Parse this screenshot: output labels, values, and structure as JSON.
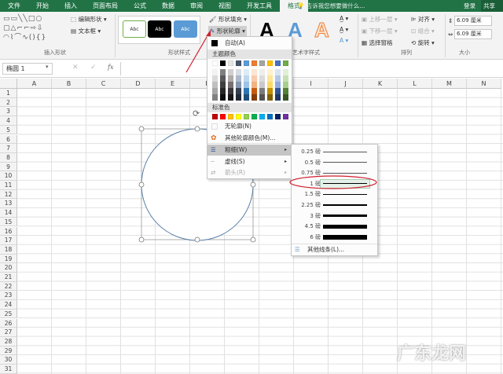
{
  "tabs": [
    "文件",
    "开始",
    "插入",
    "页面布局",
    "公式",
    "数据",
    "审阅",
    "视图",
    "开发工具",
    "格式"
  ],
  "tell_me": "告诉我您想要做什么...",
  "login": "登录",
  "share": "共享",
  "ribbon": {
    "insert_shapes": {
      "edit_shape": "编辑形状",
      "text_box": "文本框",
      "label": "插入形状"
    },
    "shape_styles": {
      "abc": "Abc",
      "fill": "形状填充",
      "outline": "形状轮廓",
      "label": "形状样式"
    },
    "wordart": {
      "letter": "A",
      "label": "艺术字样式"
    },
    "arrange": {
      "bring_forward": "上移一层",
      "send_backward": "下移一层",
      "selection_pane": "选择窗格",
      "align": "对齐",
      "group": "组合",
      "rotate": "旋转",
      "label": "排列"
    },
    "size": {
      "height": "6.09 厘米",
      "width": "6.09 厘米",
      "label": "大小"
    }
  },
  "formula_bar": {
    "name_box": "椭圆 1",
    "fx": "fx"
  },
  "columns": [
    "A",
    "B",
    "C",
    "D",
    "E",
    "F",
    "G",
    "H",
    "I",
    "J",
    "K",
    "L",
    "M",
    "N"
  ],
  "rows": [
    "1",
    "2",
    "3",
    "4",
    "5",
    "6",
    "7",
    "8",
    "9",
    "10",
    "11",
    "12",
    "13",
    "14",
    "15",
    "16",
    "17",
    "18",
    "19",
    "20",
    "21",
    "22",
    "23",
    "24",
    "25",
    "26",
    "27",
    "28",
    "29",
    "30",
    "31"
  ],
  "outline_menu": {
    "auto": "自动(A)",
    "theme_colors": "主题颜色",
    "theme_top": [
      "#ffffff",
      "#000000",
      "#e7e6e6",
      "#44546a",
      "#5b9bd5",
      "#ed7d31",
      "#a5a5a5",
      "#ffc000",
      "#4472c4",
      "#70ad47"
    ],
    "theme_shades": [
      [
        "#f2f2f2",
        "#d9d9d9",
        "#bfbfbf",
        "#a6a6a6",
        "#808080"
      ],
      [
        "#7f7f7f",
        "#595959",
        "#404040",
        "#262626",
        "#0d0d0d"
      ],
      [
        "#d0cece",
        "#aeaaaa",
        "#757171",
        "#3a3838",
        "#171616"
      ],
      [
        "#d6dce4",
        "#adb9ca",
        "#8496b0",
        "#333f4f",
        "#222a35"
      ],
      [
        "#deebf6",
        "#bdd7ee",
        "#9dc3e6",
        "#2e75b5",
        "#1f4e79"
      ],
      [
        "#fbe5d5",
        "#f7cbac",
        "#f4b183",
        "#c55a11",
        "#833c0b"
      ],
      [
        "#ededed",
        "#dbdbdb",
        "#c9c9c9",
        "#7b7b7b",
        "#525252"
      ],
      [
        "#fff2cc",
        "#fee599",
        "#ffd965",
        "#bf9000",
        "#7f6000"
      ],
      [
        "#dae3f3",
        "#b4c7e7",
        "#8faadc",
        "#2f5496",
        "#1f3864"
      ],
      [
        "#e2efd9",
        "#c5e0b3",
        "#a8d08d",
        "#538135",
        "#375623"
      ]
    ],
    "standard_colors_label": "标准色",
    "standard_colors": [
      "#c00000",
      "#ff0000",
      "#ffc000",
      "#ffff00",
      "#92d050",
      "#00b050",
      "#00b0f0",
      "#0070c0",
      "#002060",
      "#7030a0"
    ],
    "no_outline": "无轮廓(N)",
    "more_colors": "其他轮廓颜色(M)...",
    "weight": "粗细(W)",
    "dashes": "虚线(S)",
    "arrows": "箭头(R)"
  },
  "weight_menu": {
    "items": [
      {
        "label": "0.25 磅",
        "pt": 0.25
      },
      {
        "label": "0.5 磅",
        "pt": 0.5
      },
      {
        "label": "0.75 磅",
        "pt": 0.75
      },
      {
        "label": "1 磅",
        "pt": 1
      },
      {
        "label": "1.5 磅",
        "pt": 1.5
      },
      {
        "label": "2.25 磅",
        "pt": 2.25
      },
      {
        "label": "3 磅",
        "pt": 3
      },
      {
        "label": "4.5 磅",
        "pt": 4.5
      },
      {
        "label": "6 磅",
        "pt": 6
      }
    ],
    "selected": "1 磅",
    "more_lines": "其他线条(L)..."
  },
  "colors": {
    "accent": "#217346",
    "annotation": "#d02030",
    "shape_outline": "#5b7fa6"
  },
  "watermark": "广东龙网 · 软件"
}
